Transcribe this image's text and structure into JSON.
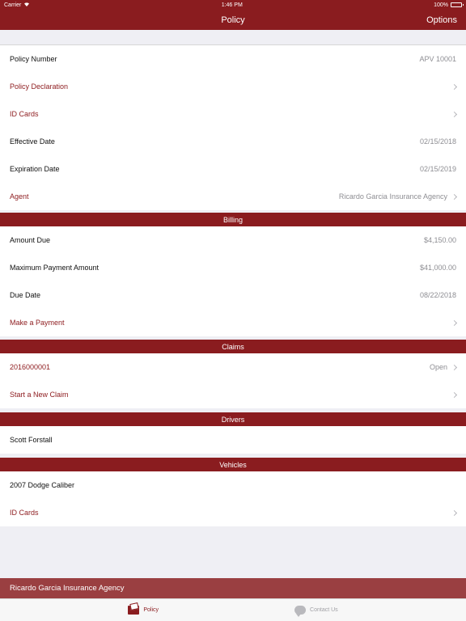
{
  "status_bar": {
    "carrier": "Carrier",
    "time": "1:46 PM",
    "battery": "100%"
  },
  "nav": {
    "title": "Policy",
    "options_label": "Options"
  },
  "policy": {
    "rows": [
      {
        "label": "Policy Number",
        "value": "APV 10001"
      },
      {
        "label": "Policy Declaration",
        "value": ""
      },
      {
        "label": "ID Cards",
        "value": ""
      },
      {
        "label": "Effective Date",
        "value": "02/15/2018"
      },
      {
        "label": "Expiration Date",
        "value": "02/15/2019"
      },
      {
        "label": "Agent",
        "value": "Ricardo Garcia Insurance Agency"
      }
    ]
  },
  "billing": {
    "header": "Billing",
    "rows": [
      {
        "label": "Amount Due",
        "value": "$4,150.00"
      },
      {
        "label": "Maximum Payment Amount",
        "value": "$41,000.00"
      },
      {
        "label": "Due Date",
        "value": "08/22/2018"
      },
      {
        "label": "Make a Payment",
        "value": ""
      }
    ]
  },
  "claims": {
    "header": "Claims",
    "rows": [
      {
        "label": "2016000001",
        "value": "Open"
      },
      {
        "label": "Start a New Claim",
        "value": ""
      }
    ]
  },
  "drivers": {
    "header": "Drivers",
    "rows": [
      {
        "label": "Scott Forstall"
      }
    ]
  },
  "vehicles": {
    "header": "Vehicles",
    "rows": [
      {
        "label": "2007 Dodge Caliber"
      },
      {
        "label": "ID Cards"
      }
    ]
  },
  "agency_bar": {
    "label": "Ricardo Garcia Insurance Agency"
  },
  "tabs": [
    {
      "label": "Policy",
      "icon": "policy-icon"
    },
    {
      "label": "Contact Us",
      "icon": "chat-icon"
    }
  ],
  "colors": {
    "brand": "#8a1c1f",
    "link": "#8f1f22",
    "agency_bar": "#9a3f41"
  }
}
